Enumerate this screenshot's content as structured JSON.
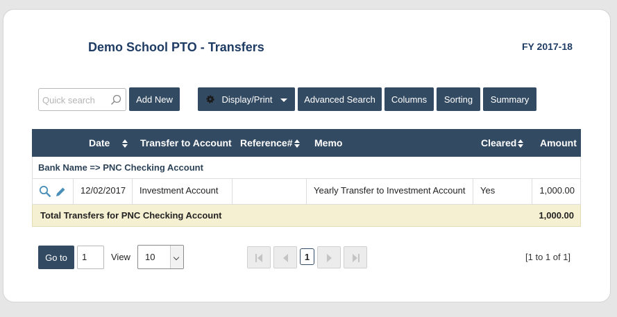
{
  "header": {
    "title": "Demo School PTO - Transfers",
    "fiscal_year": "FY 2017-18"
  },
  "toolbar": {
    "search_placeholder": "Quick search",
    "add_new": "Add New",
    "display_print": "Display/Print",
    "advanced_search": "Advanced Search",
    "columns": "Columns",
    "sorting": "Sorting",
    "summary": "Summary"
  },
  "table": {
    "columns": [
      "Date",
      "Transfer to Account",
      "Reference#",
      "Memo",
      "Cleared",
      "Amount"
    ],
    "group_label": "Bank Name => PNC Checking Account",
    "rows": [
      {
        "date": "12/02/2017",
        "account": "Investment Account",
        "reference": "",
        "memo": "Yearly Transfer to Investment Account",
        "cleared": "Yes",
        "amount": "1,000.00"
      }
    ],
    "total_label": "Total Transfers for PNC Checking Account",
    "total_amount": "1,000.00"
  },
  "pagination": {
    "goto_label": "Go to",
    "goto_value": "1",
    "view_label": "View",
    "page_size": "10",
    "current_page": "1",
    "info": "[1 to 1 of 1]"
  },
  "colors": {
    "header_bg": "#334a63",
    "title": "#1f3c64",
    "total_bg": "#f6f0d2"
  },
  "icons": [
    "search-icon",
    "gear-icon",
    "caret-down-icon",
    "sort-icon",
    "view-icon",
    "edit-icon",
    "first-page-icon",
    "prev-page-icon",
    "next-page-icon",
    "last-page-icon"
  ]
}
